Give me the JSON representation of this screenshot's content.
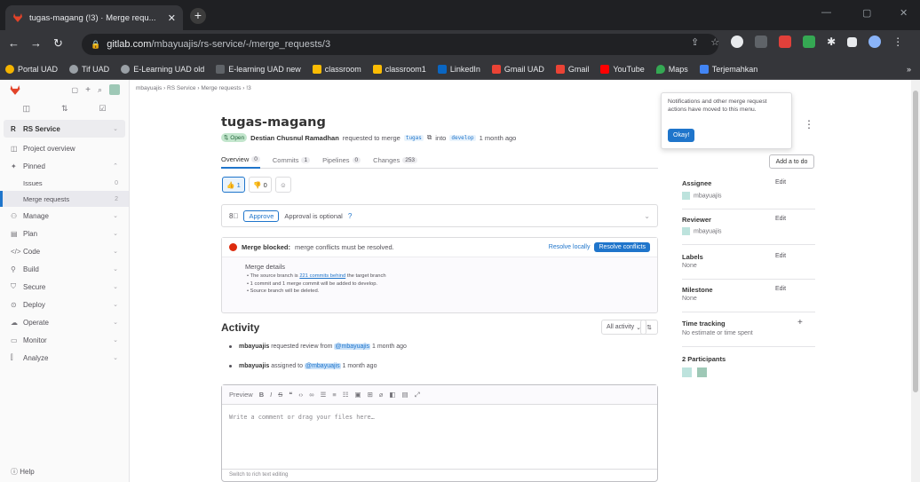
{
  "browser": {
    "tab_title": "tugas-magang (!3) · Merge requ...",
    "tab_close": "✕",
    "new_tab": "+",
    "url_host": "gitlab.com",
    "url_path": "/mbayuajis/rs-service/-/merge_requests/3",
    "bookmarks": [
      "Portal UAD",
      "Tif UAD",
      "E-Learning UAD old",
      "E-learning UAD new",
      "classroom",
      "classroom1",
      "LinkedIn",
      "Gmail UAD",
      "Gmail",
      "YouTube",
      "Maps",
      "Terjemahkan"
    ],
    "bookmarks_more": "»"
  },
  "sidebar": {
    "project": "RS Service",
    "project_overview": "Project overview",
    "pinned": "Pinned",
    "issues": "Issues",
    "issues_count": "0",
    "merge_requests": "Merge requests",
    "merge_requests_count": "2",
    "sections": [
      "Manage",
      "Plan",
      "Code",
      "Build",
      "Secure",
      "Deploy",
      "Operate",
      "Monitor",
      "Analyze"
    ],
    "help": "Help"
  },
  "breadcrumb": "mbayuajis  ›  RS Service  ›  Merge requests  ›  !3",
  "mr": {
    "title": "tugas-magang",
    "status": "Open",
    "author": "Destian Chusnul Ramadhan",
    "requested_text": "requested to merge",
    "source_branch": "tugas",
    "into_text": "into",
    "target_branch": "develop",
    "time": "1 month ago"
  },
  "tabs": [
    {
      "label": "Overview",
      "count": "0"
    },
    {
      "label": "Commits",
      "count": "1"
    },
    {
      "label": "Pipelines",
      "count": "0"
    },
    {
      "label": "Changes",
      "count": "253"
    }
  ],
  "reactions": {
    "thumbsup": "1",
    "thumbsdown": "0"
  },
  "approval": {
    "button": "Approve",
    "text": "Approval is optional"
  },
  "merge": {
    "blocked_title": "Merge blocked:",
    "blocked_text": "merge conflicts must be resolved.",
    "resolve_locally": "Resolve locally",
    "resolve_conflicts": "Resolve conflicts",
    "details_title": "Merge details",
    "line1_pre": "The source branch is",
    "line1_link": "221 commits behind",
    "line1_post": "the target branch",
    "line2": "1 commit and 1 merge commit will be added to develop.",
    "line3": "Source branch will be deleted."
  },
  "activity": {
    "title": "Activity",
    "filter": "All activity",
    "items": [
      {
        "user": "mbayuajis",
        "text": "requested review from",
        "mention": "@mbayuajis",
        "time": "1 month ago"
      },
      {
        "user": "mbayuajis",
        "text": "assigned to",
        "mention": "@mbayuajis",
        "time": "1 month ago"
      }
    ]
  },
  "editor": {
    "preview": "Preview",
    "placeholder": "Write a comment or drag your files here…",
    "footer": "Switch to rich text editing"
  },
  "right": {
    "add_todo": "Add a to do",
    "assignee_label": "Assignee",
    "assignee": "mbayuajis",
    "reviewer_label": "Reviewer",
    "reviewer": "mbayuajis",
    "labels_label": "Labels",
    "labels": "None",
    "milestone_label": "Milestone",
    "milestone": "None",
    "time_label": "Time tracking",
    "time_value": "No estimate or time spent",
    "participants": "2 Participants",
    "edit": "Edit"
  },
  "popover": {
    "text": "Notifications and other merge request actions have moved to this menu.",
    "button": "Okay!"
  },
  "colors": {
    "accent": "#1f75cb",
    "danger": "#dd2b0e",
    "browser_dark": "#35363a"
  }
}
